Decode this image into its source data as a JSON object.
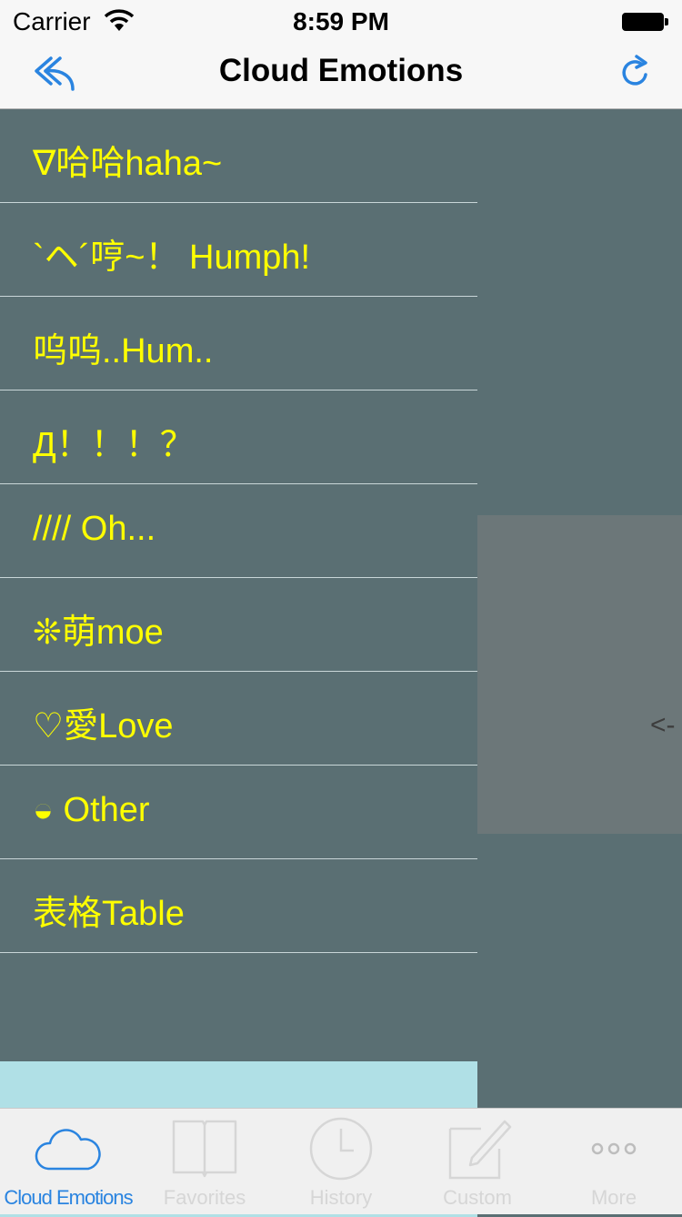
{
  "status": {
    "carrier": "Carrier",
    "time": "8:59 PM"
  },
  "nav": {
    "title": "Cloud Emotions"
  },
  "list": [
    {
      "label": "∇哈哈haha~"
    },
    {
      "label": "`ヘ´哼~！ Humph!"
    },
    {
      "label": "呜呜..Hum.."
    },
    {
      "label": "Д！！！？"
    },
    {
      "label": "//// Oh..."
    },
    {
      "label": "❊萌moe"
    },
    {
      "label": "♡愛Love"
    },
    {
      "label": "◒ Other"
    },
    {
      "label": "表格Table"
    }
  ],
  "side_panel": {
    "hint": "<-"
  },
  "tabs": [
    {
      "label": "Cloud Emotions",
      "icon": "cloud-icon",
      "active": true
    },
    {
      "label": "Favorites",
      "icon": "book-icon",
      "active": false
    },
    {
      "label": "History",
      "icon": "clock-icon",
      "active": false
    },
    {
      "label": "Custom",
      "icon": "compose-icon",
      "active": false
    },
    {
      "label": "More",
      "icon": "more-icon",
      "active": false
    }
  ],
  "colors": {
    "accent": "#2a84e0",
    "list_background": "#5a6f73",
    "label_text": "#ffff00",
    "empty_area": "#b0e0e6"
  }
}
